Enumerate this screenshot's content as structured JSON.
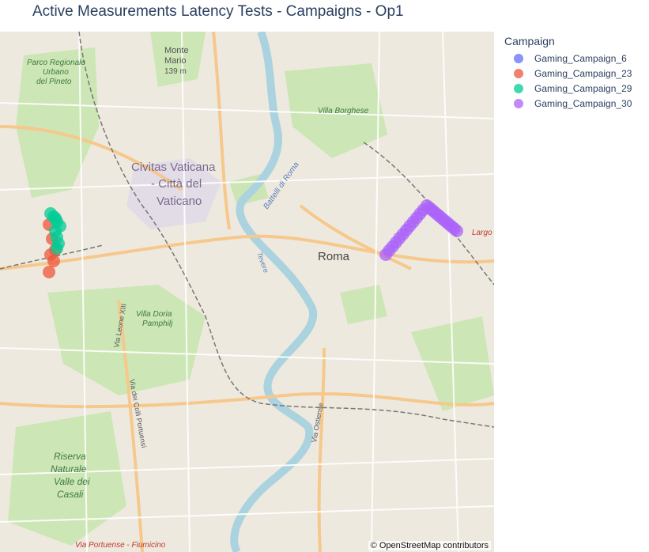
{
  "title": "Active Measurements Latency Tests - Campaigns - Op1",
  "legend": {
    "title": "Campaign",
    "items": [
      {
        "label": "Gaming_Campaign_6",
        "color": "#636efa"
      },
      {
        "label": "Gaming_Campaign_23",
        "color": "#ef553b"
      },
      {
        "label": "Gaming_Campaign_29",
        "color": "#00cc96"
      },
      {
        "label": "Gaming_Campaign_30",
        "color": "#ab63fa"
      }
    ]
  },
  "map": {
    "attribution": "© OpenStreetMap contributors",
    "labels": {
      "parco": "Parco Regionale",
      "urbano": "Urbano",
      "pineto": "del Pineto",
      "monte": "Monte",
      "mario": "Mario",
      "monte_alt": "139 m",
      "villa_borghese": "Villa Borghese",
      "civitas1": "Civitas Vaticana",
      "civitas2": "- Città del",
      "civitas3": "Vaticano",
      "battelli": "Battelli di Roma",
      "roma": "Roma",
      "villa_doria1": "Villa Doria",
      "villa_doria2": "Pamphilj",
      "via_leone": "Via Leone XIII",
      "via_colli": "Via dei Colli Portuensi",
      "via_ostiense": "Via Ostiense",
      "riserva1": "Riserva",
      "riserva2": "Naturale",
      "riserva3": "Valle dei",
      "riserva4": "Casali",
      "via_portuense": "Via Portuense - Fiumicino",
      "largo": "Largo",
      "tevere": "Tevere"
    }
  }
}
